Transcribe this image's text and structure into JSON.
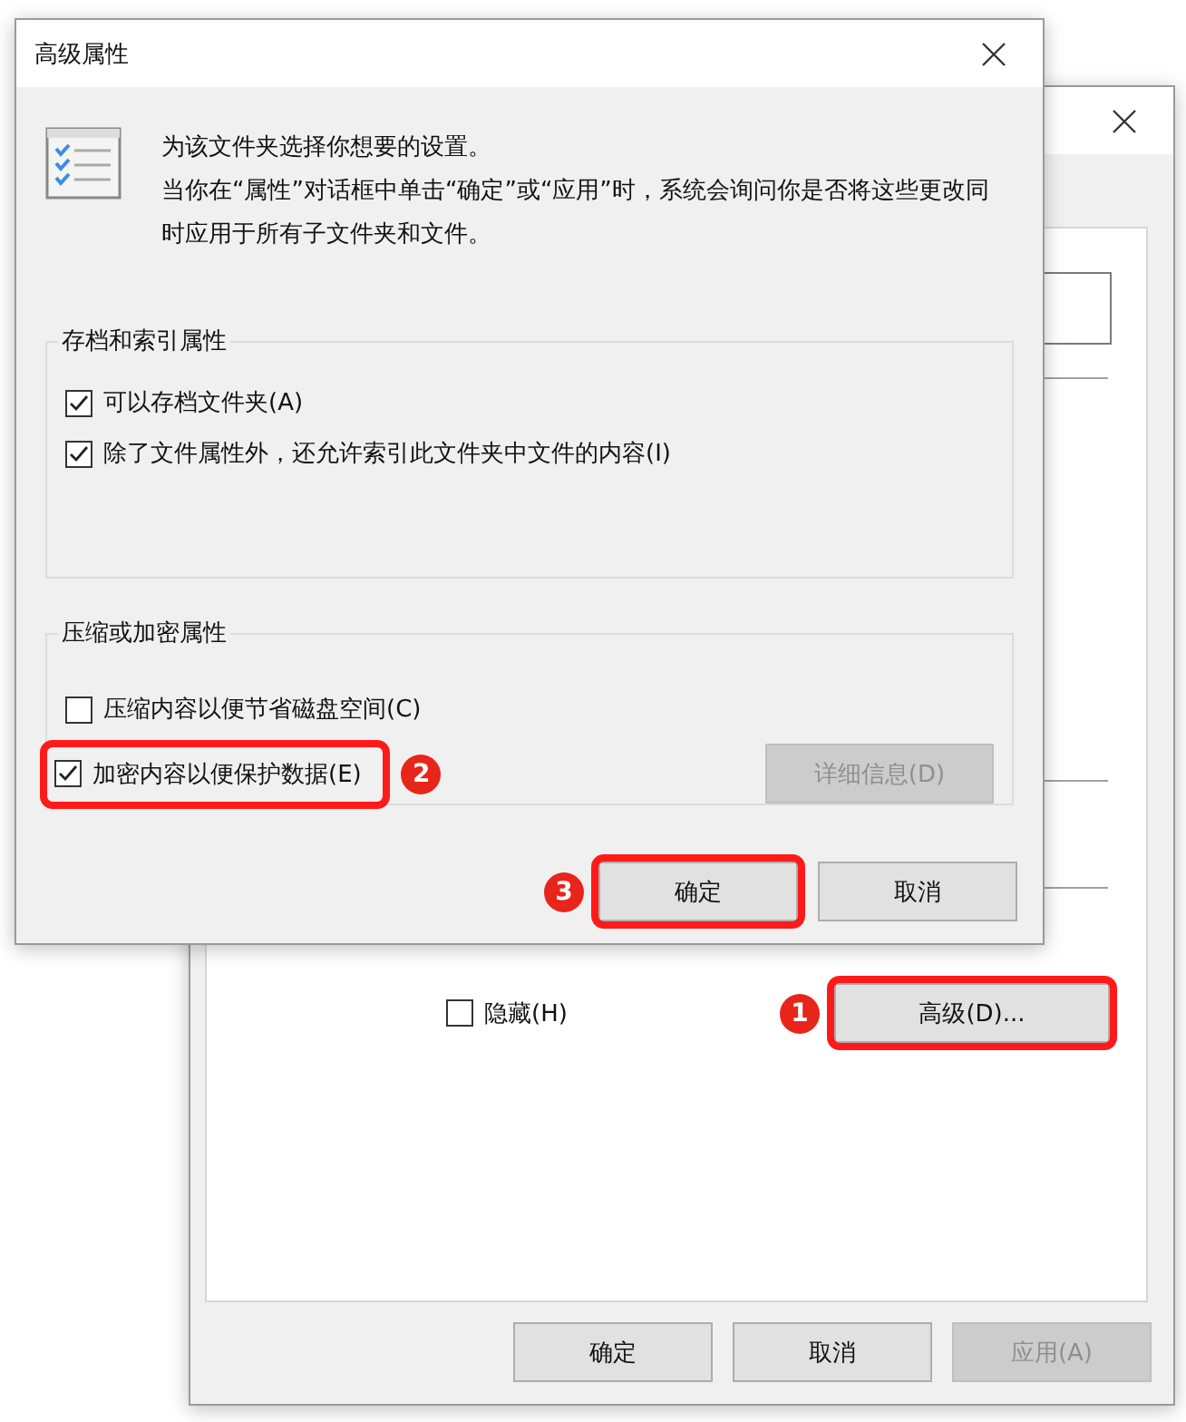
{
  "dialog": {
    "title": "高级属性",
    "intro": "为该文件夹选择你想要的设置。",
    "description": "当你在“属性”对话框中单击“确定”或“应用”时，系统会询问你是否将这些更改同时应用于所有子文件夹和文件。",
    "groups": [
      {
        "title": "存档和索引属性",
        "options": [
          {
            "label": "可以存档文件夹(A)",
            "checked": true,
            "highlighted": false
          },
          {
            "label": "除了文件属性外，还允许索引此文件夹中文件的内容(I)",
            "checked": true,
            "highlighted": false
          }
        ]
      },
      {
        "title": "压缩或加密属性",
        "options": [
          {
            "label": "压缩内容以便节省磁盘空间(C)",
            "checked": false,
            "highlighted": false
          },
          {
            "label": "加密内容以便保护数据(E)",
            "checked": true,
            "highlighted": true,
            "badge": "2"
          }
        ],
        "button": {
          "label": "详细信息(D)",
          "disabled": true
        }
      }
    ],
    "buttons": [
      {
        "label": "确定",
        "disabled": false,
        "highlighted": true,
        "badge": "3"
      },
      {
        "label": "取消",
        "disabled": false,
        "highlighted": false
      }
    ]
  },
  "back_window": {
    "hidden_checkbox": {
      "label": "隐藏(H)",
      "checked": false
    },
    "advanced_button": {
      "label": "高级(D)...",
      "highlighted": true,
      "badge": "1"
    },
    "buttons": [
      {
        "label": "确定",
        "disabled": false
      },
      {
        "label": "取消",
        "disabled": false
      },
      {
        "label": "应用(A)",
        "disabled": true
      }
    ]
  }
}
